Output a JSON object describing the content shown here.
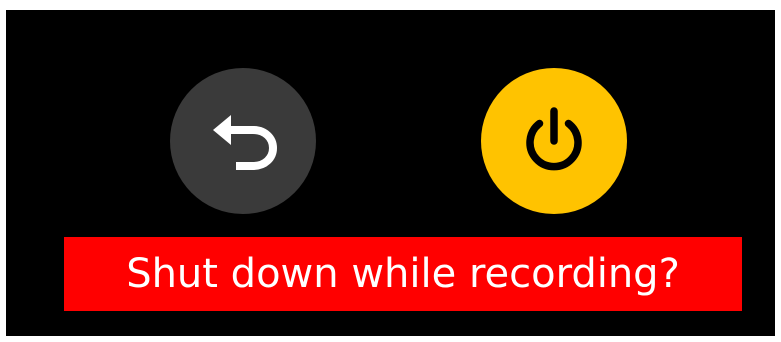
{
  "colors": {
    "screen_background": "#000000",
    "back_button_background": "#3a3a3a",
    "power_button_background": "#ffc300",
    "power_icon_color": "#000000",
    "back_icon_color": "#ffffff",
    "banner_background": "#ff0000",
    "banner_text_color": "#ffffff"
  },
  "buttons": {
    "back": {
      "icon": "undo-arrow-icon"
    },
    "power": {
      "icon": "power-icon"
    }
  },
  "dialog": {
    "message": "Shut down while recording?"
  }
}
